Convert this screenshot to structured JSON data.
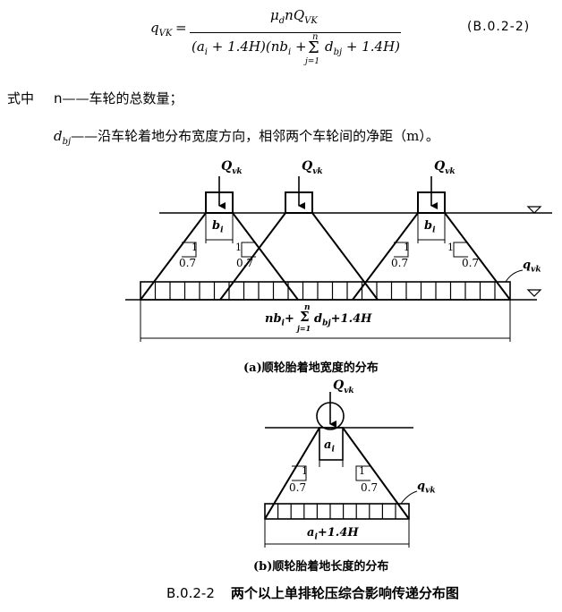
{
  "formula": {
    "lhs": "q",
    "lhs_sub": "VK",
    "equals": "=",
    "numerator": "μ",
    "numerator_sub": "d",
    "numerator_rest": "nQ",
    "numerator_rest_sub": "VK",
    "den_part1": "(a",
    "den_part1_sub": "i",
    "den_part2": " + 1.4H)(nb",
    "den_part2_sub": "i",
    "den_part3": " + ",
    "sum_symbol": "Σ",
    "sum_upper": "n",
    "sum_lower": "j=1",
    "den_part4": "d",
    "den_part4_sub": "bj",
    "den_part5": " + 1.4H)",
    "number": "(B.0.2-2)"
  },
  "definitions": {
    "lead": "式中",
    "n_symbol": "n",
    "n_text": "——车轮的总数量；",
    "d_symbol": "d",
    "d_sub": "bj",
    "d_text": "——沿车轮着地分布宽度方向，相邻两个车轮间的净距（m）。"
  },
  "diagram_a": {
    "loads": [
      "Q",
      "Q",
      "Q"
    ],
    "load_sub": "vk",
    "b_label": "b",
    "b_sub": "i",
    "slope_one": "1",
    "slope_ratio": "0.7",
    "q_label": "q",
    "q_sub": "vk",
    "dim_main": "nb",
    "dim_main_sub": "i",
    "dim_plus": "+",
    "dim_sum": "Σ",
    "dim_sum_upper": "n",
    "dim_sum_lower": "j=1",
    "dim_d": "d",
    "dim_d_sub": "bj",
    "dim_tail": "+1.4H",
    "caption": "(a)顺轮胎着地宽度的分布"
  },
  "diagram_b": {
    "load": "Q",
    "load_sub": "vk",
    "a_label": "a",
    "a_sub": "i",
    "slope_one": "1",
    "slope_ratio": "0.7",
    "q_label": "q",
    "q_sub": "vk",
    "dim": "a",
    "dim_sub": "i",
    "dim_tail": "+1.4H",
    "caption": "(b)顺轮胎着地长度的分布"
  },
  "figure_title": {
    "number": "B.0.2-2",
    "text": "两个以上单排轮压综合影响传递分布图"
  }
}
